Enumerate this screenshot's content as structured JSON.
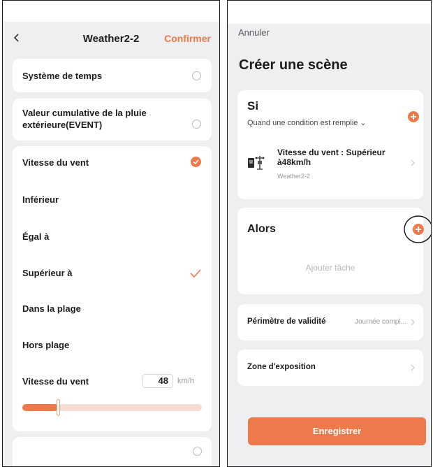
{
  "left": {
    "header": {
      "title": "Weather2-2",
      "confirm_label": "Confirmer"
    },
    "options": [
      {
        "label": "Système de temps",
        "selected": false
      },
      {
        "label": "Valeur cumulative de la pluie\nextérieure(EVENT)",
        "selected": false
      }
    ],
    "wind_card": {
      "title": "Vitesse du vent",
      "selected": true,
      "operators": [
        {
          "label": "Inférieur",
          "checked": false
        },
        {
          "label": "Égal à",
          "checked": false
        },
        {
          "label": "Supérieur à",
          "checked": true
        },
        {
          "label": "Dans la plage",
          "checked": false
        },
        {
          "label": "Hors plage",
          "checked": false
        }
      ],
      "value_label": "Vitesse du vent",
      "value": "48",
      "unit": "km/h",
      "slider_fraction": 0.2
    },
    "accent_color": "#ee7a4b"
  },
  "right": {
    "cancel_label": "Annuler",
    "title": "Créer une scène",
    "if_section": {
      "title": "Si",
      "subtitle": "Quand une condition est remplie ⌄",
      "condition": {
        "title": "Vitesse du vent : Supérieur à48km/h",
        "device": "Weather2-2",
        "icon": "weather-station-icon"
      }
    },
    "then_section": {
      "title": "Alors",
      "placeholder": "Ajouter tâche"
    },
    "validity": {
      "label": "Périmètre de validité",
      "value": "Journée compl..."
    },
    "exposure": {
      "label": "Zone d'exposition"
    },
    "save_label": "Enregistrer"
  }
}
